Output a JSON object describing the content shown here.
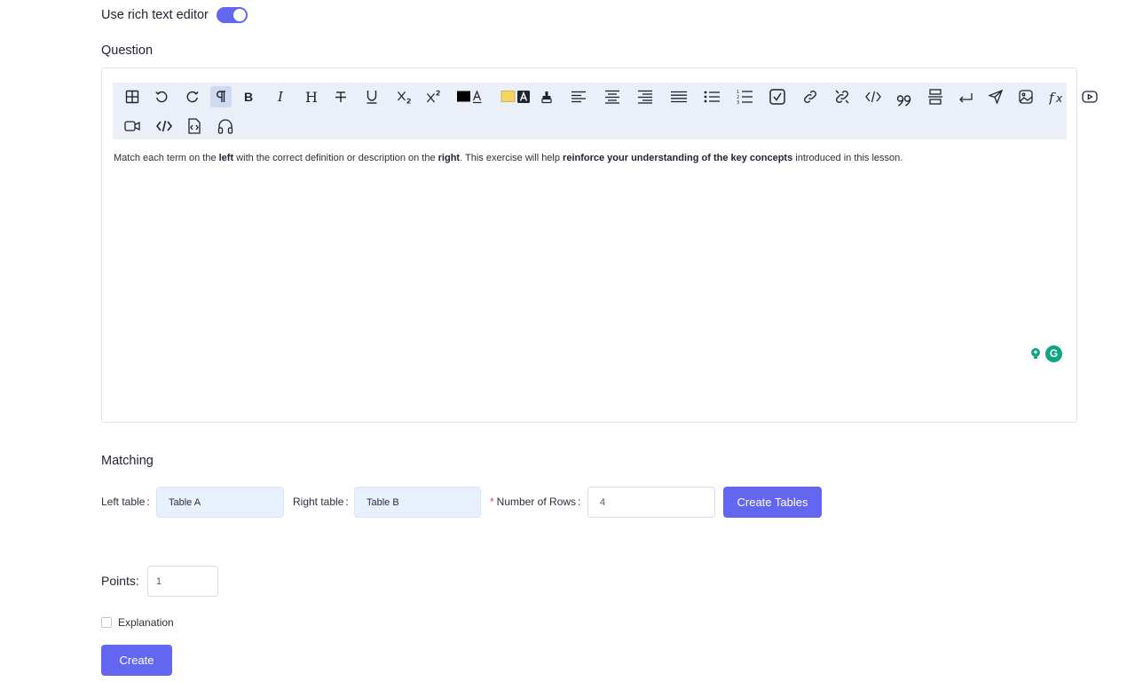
{
  "toggle": {
    "label": "Use rich text editor",
    "on": true
  },
  "question": {
    "label": "Question"
  },
  "editor": {
    "toolbar_row1": [
      "table-icon",
      "undo-icon",
      "redo-icon",
      "paragraph-icon",
      "bold-icon",
      "italic-icon",
      "heading-icon",
      "strikethrough-icon",
      "underline-icon",
      "subscript-icon",
      "superscript-icon",
      "text-color-icon",
      "highlight-color-icon",
      "clear-format-icon",
      "align-left-icon",
      "align-center-icon",
      "align-right-icon",
      "align-justify-icon",
      "bullet-list-icon",
      "numbered-list-icon",
      "task-list-icon",
      "link-icon",
      "unlink-icon",
      "code-inline-icon",
      "blockquote-icon",
      "horizontal-rule-icon",
      "hard-break-icon",
      "send-icon",
      "image-icon",
      "formula-icon",
      "youtube-icon"
    ],
    "toolbar_row2": [
      "video-icon",
      "code-block-icon",
      "file-code-icon",
      "audio-icon"
    ],
    "content": {
      "p1": "Match each term on the ",
      "b1": "left",
      "p2": " with the correct definition or description on the ",
      "b2": "right",
      "p3": ". This exercise will help ",
      "b3": "reinforce your understanding of the key concepts",
      "p4": " introduced in this lesson."
    },
    "grammarly_letter": "G",
    "colors": {
      "text_swatch": "#000000",
      "highlight_swatch": "#f7d560"
    }
  },
  "matching": {
    "label": "Matching",
    "left_label": "Left table",
    "left_value": "Table A",
    "right_label": "Right table",
    "right_value": "Table B",
    "required_mark": "*",
    "rows_label": "Number of Rows",
    "rows_value": "4",
    "colon": ":",
    "create_tables_label": "Create Tables"
  },
  "points": {
    "label": "Points:",
    "value": "1"
  },
  "explanation": {
    "label": "Explanation",
    "checked": false
  },
  "create_button": {
    "label": "Create"
  },
  "colors": {
    "accent": "#6366f1",
    "input_fill": "#e8effd",
    "toolbar_bg": "#eaeff8"
  }
}
